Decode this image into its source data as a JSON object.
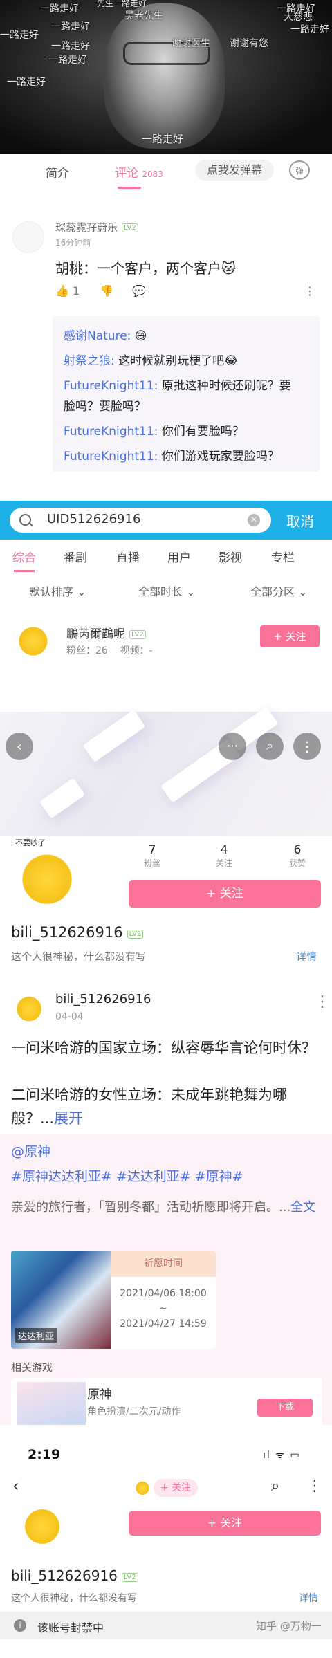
{
  "video": {
    "danmaku": [
      "一路走好",
      "一路走好",
      "一路走好",
      "一路走好",
      "先生一路走好",
      "吴老先生",
      "大慈悲",
      "一路走好",
      "一路走好",
      "一路走好",
      "谢谢医生",
      "谢谢有您",
      "一路走好",
      "一路走好"
    ],
    "subtitle": "一路走好"
  },
  "tabs": {
    "intro": "简介",
    "comments": "评论",
    "comment_count": "2083",
    "danmaku_btn": "点我发弹幕",
    "tv_icon": "弹"
  },
  "comment": {
    "user": "琛蕊霓孖蔚乐",
    "level": "LV2",
    "time": "16分钟前",
    "text": "胡桃：一个客户，两个客户🐱",
    "likes": "1",
    "replies": [
      {
        "name": "感谢Nature:",
        "text": " 😄"
      },
      {
        "name": "射祭之狼:",
        "text": " 这时候就别玩梗了吧😂"
      },
      {
        "name": "FutureKnight11:",
        "text": " 原批这种时候还刷呢？要"
      },
      {
        "name": "",
        "text": "脸吗？要脸吗？"
      },
      {
        "name": "FutureKnight11:",
        "text": " 你们有要脸吗？"
      },
      {
        "name": "FutureKnight11:",
        "text": " 你们游戏玩家要脸吗？"
      }
    ]
  },
  "search": {
    "query": "UID512626916",
    "cancel": "取消",
    "categories": [
      "综合",
      "番剧",
      "直播",
      "用户",
      "影视",
      "专栏"
    ],
    "filters": [
      "默认排序",
      "全部时长",
      "全部分区"
    ],
    "result": {
      "name": "鵬芮爾鶓呢",
      "level": "LV2",
      "fans_label": "粉丝：",
      "fans": "26",
      "videos_label": "视频：",
      "videos": "-",
      "follow": "+ 关注"
    }
  },
  "profile": {
    "stats": [
      {
        "n": "7",
        "l": "粉丝"
      },
      {
        "n": "4",
        "l": "关注"
      },
      {
        "n": "6",
        "l": "获赞"
      }
    ],
    "follow": "+ 关注",
    "name": "bili_512626916",
    "level": "LV2",
    "desc": "这个人很神秘，什么都没有写",
    "detail": "详情",
    "avatar_text": "不要吵了"
  },
  "post": {
    "author": "bili_512626916",
    "date": "04-04",
    "line1": "一问米哈游的国家立场：纵容辱华言论何时休？",
    "line2": "二问米哈游的女性立场：未成年跳艳舞为哪般？...",
    "expand": "展开",
    "at": "@原神",
    "tags": "#原神达达利亚# #达达利亚# #原神#",
    "body": "亲爱的旅行者，「暂别冬都」活动祈愿即将开启。...",
    "fulltext": "全文",
    "card": {
      "tag": "达达利亚",
      "title": "祈愿时间",
      "d1": "2021/04/06 18:00",
      "sep": "~",
      "d2": "2021/04/27 14:59"
    },
    "related": "相关游戏",
    "game": {
      "name": "原神",
      "sub": "角色扮演/二次元/动作",
      "btn": "下载"
    }
  },
  "bottom": {
    "time": "2:19",
    "sys": "ıl ᯤ ▭",
    "follow": "+ 关注",
    "name": "bili_512626916",
    "level": "LV2",
    "desc": "这个人很神秘，什么都没有写",
    "detail": "详情",
    "ban": "该账号封禁中",
    "watermark": "知乎 @万物一"
  },
  "colors": {
    "accent": "#fb7299",
    "search_bar": "#1fb0e8",
    "link": "#4a6fd8"
  }
}
